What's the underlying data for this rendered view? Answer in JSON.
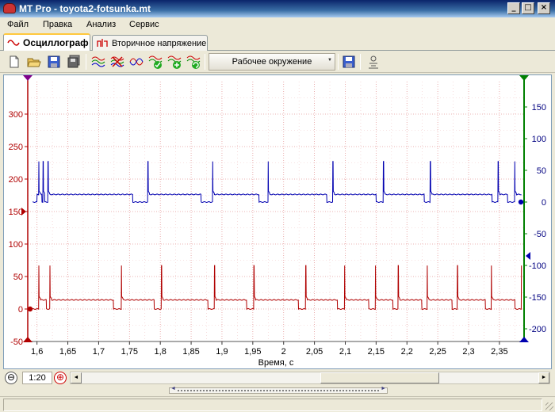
{
  "window": {
    "title": "MT Pro - toyota2-fotsunka.mt",
    "controls": {
      "minimize": "_",
      "maximize": "□",
      "close": "×"
    }
  },
  "menu": [
    {
      "label": "Файл"
    },
    {
      "label": "Правка"
    },
    {
      "label": "Анализ"
    },
    {
      "label": "Сервис"
    }
  ],
  "tabs": [
    {
      "label": "Осциллограф",
      "active": true,
      "icon": "sine-wave-icon"
    },
    {
      "label": "Вторичное напряжение",
      "active": false,
      "icon": "ignition-icon"
    }
  ],
  "toolbar": {
    "environment_label": "Рабочее окружение",
    "icons": [
      "new-file-icon",
      "open-folder-icon",
      "save-icon",
      "save-all-icon",
      "channels-icon",
      "channels-off-icon",
      "channel-link-icon",
      "channel-ok-icon",
      "channel-add-icon",
      "channel-refresh-icon",
      "save-environment-icon",
      "export-icon"
    ]
  },
  "chart_data": {
    "type": "line",
    "xlabel": "Время, с",
    "x_ticks": [
      "1,6",
      "1,65",
      "1,7",
      "1,75",
      "1,8",
      "1,85",
      "1,9",
      "1,95",
      "2",
      "2,05",
      "2,1",
      "2,15",
      "2,2",
      "2,25",
      "2,3",
      "2,35"
    ],
    "xlim": [
      1.585,
      2.39
    ],
    "left_axis": {
      "ticks": [
        "-50",
        "0",
        "50",
        "100",
        "150",
        "200",
        "250",
        "300"
      ],
      "ylim": [
        -50,
        350
      ]
    },
    "right_axis": {
      "ticks": [
        "-200",
        "-150",
        "-100",
        "-50",
        "0",
        "50",
        "100",
        "150"
      ],
      "ylim": [
        -220,
        190
      ]
    },
    "grid": true,
    "series": [
      {
        "color": "#b00000",
        "axis": "left",
        "baseline": 14,
        "low": 0,
        "spike_peak": 67,
        "low_intervals": [
          [
            1.593,
            1.604
          ],
          [
            1.615,
            1.621
          ],
          [
            1.724,
            1.737
          ],
          [
            1.79,
            1.802
          ],
          [
            1.877,
            1.888
          ],
          [
            1.94,
            1.952
          ],
          [
            2.024,
            2.036
          ],
          [
            2.087,
            2.099
          ],
          [
            2.138,
            2.149
          ],
          [
            2.177,
            2.186
          ],
          [
            2.224,
            2.233
          ],
          [
            2.273,
            2.282
          ],
          [
            2.327,
            2.337
          ],
          [
            2.375,
            2.386
          ]
        ],
        "spikes": [
          1.603,
          1.621,
          1.737,
          1.802,
          1.888,
          1.952,
          2.036,
          2.099,
          2.149,
          2.186,
          2.233,
          2.282,
          2.337,
          2.386
        ]
      },
      {
        "color": "#0000b0",
        "axis": "right",
        "baseline": 12,
        "low": 0,
        "spike_peak": 64,
        "low_intervals": [
          [
            1.593,
            1.6
          ],
          [
            1.608,
            1.618
          ],
          [
            1.755,
            1.78
          ],
          [
            1.866,
            1.885
          ],
          [
            1.96,
            1.975
          ],
          [
            2.07,
            2.08
          ],
          [
            2.15,
            2.162
          ],
          [
            2.228,
            2.238
          ],
          [
            2.338,
            2.348
          ],
          [
            2.363,
            2.375
          ]
        ],
        "spikes": [
          1.603,
          1.61,
          1.618,
          1.78,
          1.885,
          1.975,
          2.08,
          2.162,
          2.238,
          2.348,
          2.375
        ]
      }
    ]
  },
  "bottom": {
    "zoom_out": "⊖",
    "zoom_level": "1:20",
    "zoom_in": "⊕",
    "scroll_left": "◄",
    "scroll_right": "►",
    "split_left": "◄",
    "split_right": "►"
  }
}
